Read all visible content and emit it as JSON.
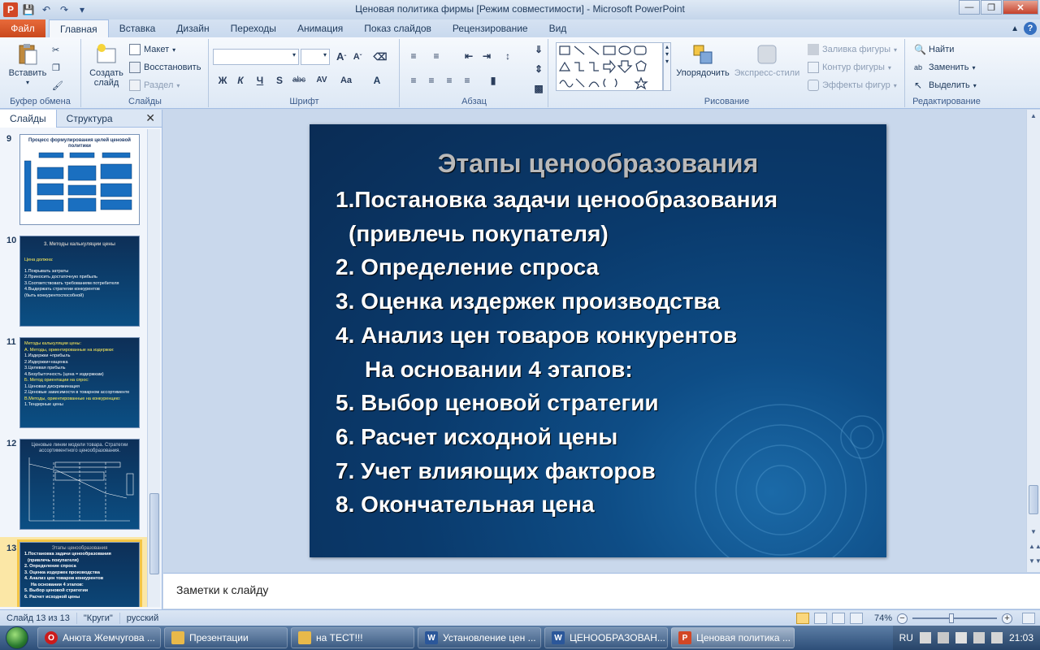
{
  "window": {
    "title": "Ценовая политика фирмы [Режим совместимости] - Microsoft PowerPoint",
    "app_icon_letter": "P"
  },
  "ribbon_tabs": {
    "file": "Файл",
    "items": [
      "Главная",
      "Вставка",
      "Дизайн",
      "Переходы",
      "Анимация",
      "Показ слайдов",
      "Рецензирование",
      "Вид"
    ]
  },
  "ribbon": {
    "clipboard": {
      "paste": "Вставить",
      "label": "Буфер обмена"
    },
    "slides": {
      "new_slide": "Создать слайд",
      "layout": "Макет",
      "reset": "Восстановить",
      "section": "Раздел",
      "label": "Слайды"
    },
    "font": {
      "label": "Шрифт",
      "bold": "Ж",
      "italic": "К",
      "underline": "Ч",
      "shadow": "S",
      "strike": "abc",
      "spacing": "AV",
      "case": "Aa"
    },
    "paragraph": {
      "label": "Абзац"
    },
    "drawing": {
      "arrange": "Упорядочить",
      "quick_styles": "Экспресс-стили",
      "fill": "Заливка фигуры",
      "outline": "Контур фигуры",
      "effects": "Эффекты фигур",
      "label": "Рисование"
    },
    "editing": {
      "find": "Найти",
      "replace": "Заменить",
      "select": "Выделить",
      "label": "Редактирование"
    }
  },
  "left_panel": {
    "tab_slides": "Слайды",
    "tab_outline": "Структура",
    "thumbnails": [
      {
        "num": "9",
        "title": "Процесс формулирования целей ценовой политики"
      },
      {
        "num": "10",
        "title": "3. Методы калькуляции цены",
        "yellow": "Цена должна:",
        "lines": [
          "1.Покрывать затраты",
          "2.Приносить достаточную прибыль",
          "3.Соответствовать требованиям потребителя",
          "4.Выдержать стратегии конкурентов",
          "(быть конкурентоспособной)"
        ]
      },
      {
        "num": "11",
        "yellow": "Методы калькуляции цены:",
        "lines": [
          "А. Методы, ориентированные на издержки:",
          "1.Издержки +прибыль",
          "2.Издержки+наценка",
          "3.Целевая прибыль",
          "4.Безубыточность (цена = издержкам)",
          "Б. Метод ориентации на спрос:",
          "1.Ценовая дискриминация",
          "2.Ценовые зависимости в товарном ассортименте",
          "В.Методы, ориентированные на конкуренцию:",
          "1.Тендерные цены"
        ]
      },
      {
        "num": "12",
        "title": "Ценовые линии модели товара. Стратегии ассортиментного ценообразования."
      },
      {
        "num": "13",
        "title": "Этапы ценообразования",
        "lines": [
          "1.Постановка задачи ценообразования",
          "(привлечь покупателя)",
          "2. Определение спроса",
          "3. Оценка издержек производства",
          "4. Анализ цен товаров конкурентов",
          "На основании 4 этапов:",
          "5. Выбор ценовой стратегии",
          "6. Расчет исходной цены"
        ]
      }
    ]
  },
  "slide": {
    "title": "Этапы ценообразования",
    "items": [
      "1.Постановка задачи ценообразования",
      "(привлечь покупателя)",
      "2. Определение спроса",
      "3. Оценка издержек производства",
      "4. Анализ цен товаров конкурентов",
      "На основании 4 этапов:",
      "5. Выбор ценовой стратегии",
      "6. Расчет исходной цены",
      "7. Учет влияющих факторов",
      "8. Окончательная цена"
    ]
  },
  "notes": {
    "placeholder": "Заметки к слайду"
  },
  "status": {
    "slide_counter": "Слайд 13 из 13",
    "theme": "\"Круги\"",
    "language": "русский",
    "zoom": "74%",
    "zoom_fraction": 0.46
  },
  "taskbar": {
    "items": [
      {
        "label": "Анюта Жемчугова ...",
        "icon": "opera-icon",
        "color": "#cc1b1b",
        "letter": "O"
      },
      {
        "label": "Презентации",
        "icon": "folder-icon",
        "color": "#e8b94a",
        "letter": ""
      },
      {
        "label": "на ТЕСТ!!!",
        "icon": "folder-icon",
        "color": "#e8b94a",
        "letter": ""
      },
      {
        "label": "Установление цен ...",
        "icon": "word-icon",
        "color": "#2b579a",
        "letter": "W"
      },
      {
        "label": "ЦЕНООБРАЗОВАН...",
        "icon": "word-icon",
        "color": "#2b579a",
        "letter": "W"
      },
      {
        "label": "Ценовая политика ...",
        "icon": "powerpoint-icon",
        "color": "#d24726",
        "letter": "P"
      }
    ],
    "lang": "RU",
    "clock": "21:03"
  }
}
